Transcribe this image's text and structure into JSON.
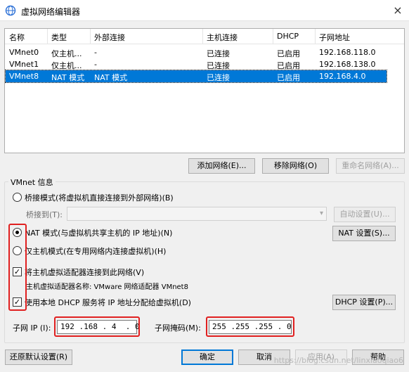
{
  "window": {
    "title": "虚拟网络编辑器",
    "close_glyph": "×"
  },
  "network_table": {
    "columns": [
      "名称",
      "类型",
      "外部连接",
      "主机连接",
      "DHCP",
      "子网地址"
    ],
    "rows": [
      {
        "name": "VMnet0",
        "type": "仅主机...",
        "external": "-",
        "host": "已连接",
        "dhcp": "已启用",
        "subnet": "192.168.118.0"
      },
      {
        "name": "VMnet1",
        "type": "仅主机...",
        "external": "-",
        "host": "已连接",
        "dhcp": "已启用",
        "subnet": "192.168.138.0"
      },
      {
        "name": "VMnet8",
        "type": "NAT 模式",
        "external": "NAT 模式",
        "host": "已连接",
        "dhcp": "已启用",
        "subnet": "192.168.4.0"
      }
    ],
    "selected_row": 2
  },
  "table_buttons": {
    "add": "添加网络(E)...",
    "remove": "移除网络(O)",
    "rename": "重命名网络(A)..."
  },
  "vmnet_info": {
    "group_title": "VMnet 信息",
    "bridged_label": "桥接模式(将虚拟机直接连接到外部网络)(B)",
    "bridged_to_label": "桥接到(T):",
    "auto_settings": "自动设置(U)...",
    "nat_label": "NAT 模式(与虚拟机共享主机的 IP 地址)(N)",
    "nat_settings": "NAT 设置(S)...",
    "hostonly_label": "仅主机模式(在专用网络内连接虚拟机)(H)",
    "selected_mode": "nat",
    "connect_adapter_label": "将主机虚拟适配器连接到此网络(V)",
    "connect_adapter_checked": true,
    "adapter_name_text": "主机虚拟适配器名称: VMware 网络适配器 VMnet8",
    "use_dhcp_label": "使用本地 DHCP 服务将 IP 地址分配给虚拟机(D)",
    "use_dhcp_checked": true,
    "dhcp_settings": "DHCP 设置(P)...",
    "subnet_ip_label": "子网 IP (I):",
    "subnet_ip_value": "192 .168 . 4  . 0",
    "subnet_mask_label": "子网掩码(M):",
    "subnet_mask_value": "255 .255 .255 . 0"
  },
  "footer_buttons": {
    "restore": "还原默认设置(R)",
    "ok": "确定",
    "cancel": "取消",
    "apply": "应用(A)",
    "help": "帮助"
  },
  "colors": {
    "selection": "#0078d7",
    "highlight_box": "#e02020"
  },
  "watermark": "https://blog.csdn.net/linxiaoqiao6"
}
